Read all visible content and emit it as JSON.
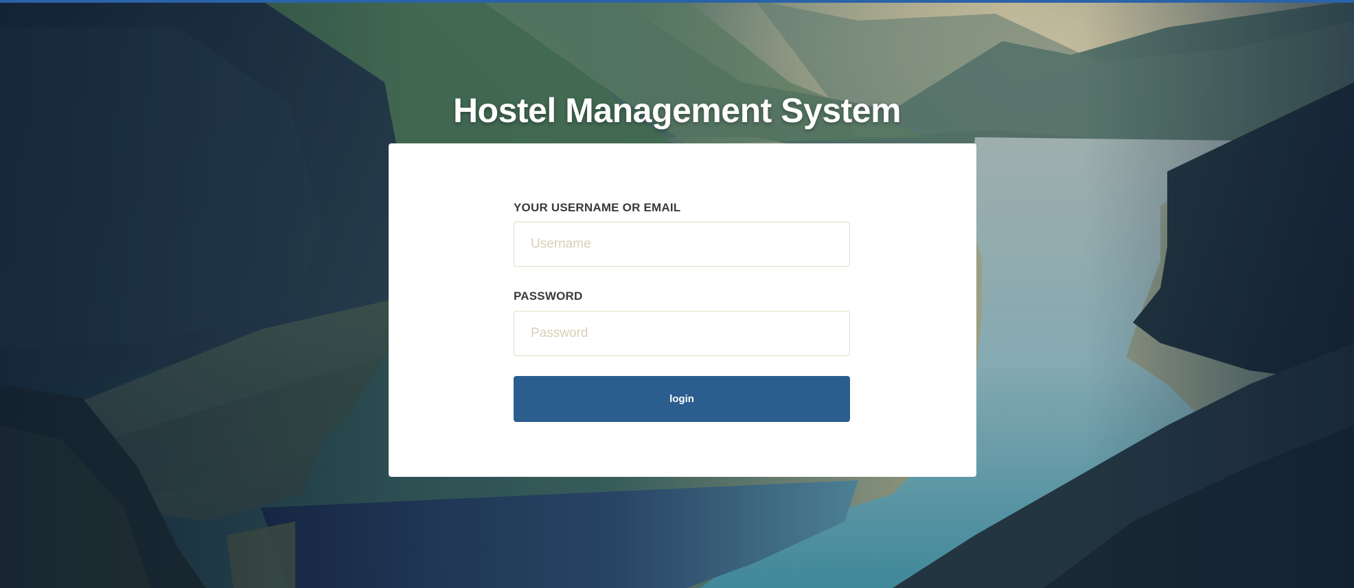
{
  "page": {
    "title": "Hostel Management System"
  },
  "login_form": {
    "username_label": "YOUR USERNAME OR EMAIL",
    "username_placeholder": "Username",
    "username_value": "",
    "password_label": "PASSWORD",
    "password_placeholder": "Password",
    "password_value": "",
    "login_button_label": "login"
  },
  "colors": {
    "top_bar": "#2a63a8",
    "login_button": "#2b5d8e",
    "card_background": "#ffffff",
    "title_text": "#ffffff",
    "input_border": "#e3dcc6"
  }
}
